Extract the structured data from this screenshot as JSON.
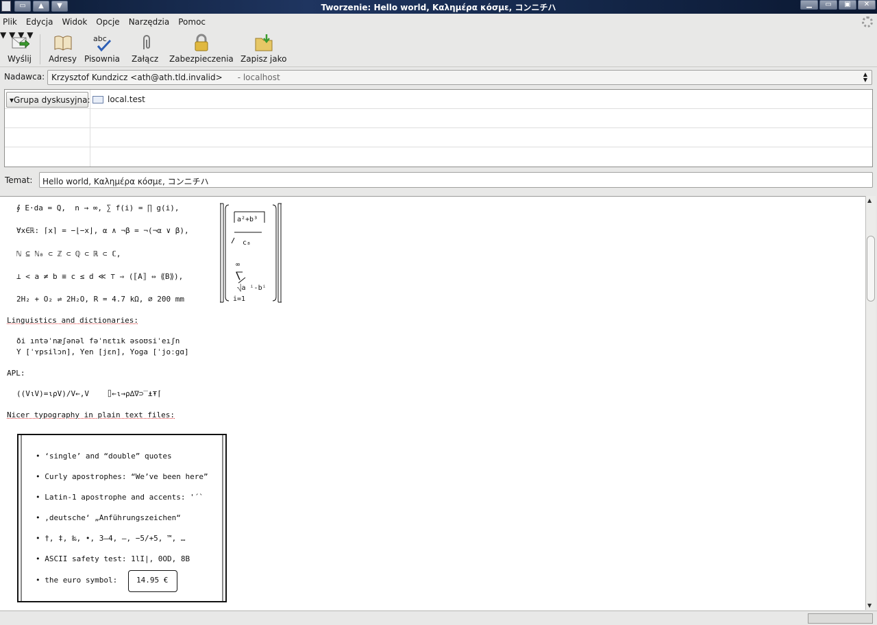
{
  "window": {
    "title": "Tworzenie: Hello world, Καλημέρα κόσμε, コンニチハ"
  },
  "menu": {
    "items": [
      "Plik",
      "Edycja",
      "Widok",
      "Opcje",
      "Narzędzia",
      "Pomoc"
    ]
  },
  "toolbar": {
    "send_label": "Wyślij",
    "addresses_label": "Adresy",
    "spelling_label": "Pisownia",
    "attach_label": "Załącz",
    "security_label": "Zabezpieczenia",
    "save_label": "Zapisz jako",
    "spelling_icon_text": "abc"
  },
  "sender": {
    "label": "Nadawca:",
    "value": "Krzysztof Kundzicz <ath@ath.tld.invalid>",
    "host": "- localhost"
  },
  "recipients": {
    "type_label": "Grupa dyskusyjna:",
    "value": "local.test"
  },
  "subject": {
    "label": "Temat:",
    "value": "Hello world, Καλημέρα κόσμε, コンニチハ"
  },
  "body": {
    "line1": "∮ E⋅da = Q,  n → ∞, ∑ f(i) = ∏ g(i),",
    "line2": "∀x∈ℝ: ⌈x⌉ = −⌊−x⌋, α ∧ ¬β = ¬(¬α ∨ β),",
    "line3": "ℕ ⊆ ℕ₀ ⊂ ℤ ⊂ ℚ ⊂ ℝ ⊂ ℂ,",
    "line4": "⊥ < a ≠ b ≡ c ≤ d ≪ ⊤ ⇒ (⟦A⟧ ⇔ ⟪B⟫),",
    "line5": "2H₂ + O₂ ⇌ 2H₂O, R = 4.7 kΩ, ⌀ 200 mm",
    "heading_ling": "Linguistics and dictionaries:",
    "ipa": "ði ıntəˈnæʃənəl fəˈnɛtık əsoʊsiˈeıʃn",
    "ypsilon": "Y [ˈʏpsilɔn], Yen [jɛn], Yoga [ˈjoːgɑ]",
    "heading_apl": "APL:",
    "apl": "((V⍳V)=⍳⍴V)/V←,V    ⌷←⍳→⍴∆∇⊃‾⍎⍕⌈",
    "heading_typo": "Nicer typography in plain text files:",
    "bullet1": "• ‘single’ and “double” quotes",
    "bullet2": "• Curly apostrophes: “We’ve been here”",
    "bullet3": "• Latin-1 apostrophe and accents: '´`",
    "bullet4": "• ‚deutsche‘ „Anführungszeichen“",
    "bullet5": "• †, ‡, ‰, •, 3–4, —, −5/+5, ™, …",
    "bullet6": "• ASCII safety test: 1lI|, 0OD, 8B",
    "bullet7": "• the euro symbol:",
    "euro": "14.95 €",
    "matrix_top": "a²+b³",
    "matrix_frac": "c₈",
    "matrix_inf": "∞",
    "matrix_sum": "⎲",
    "matrix_root": "⎷a ⁱ-bⁱ",
    "matrix_idx": "i=1"
  }
}
